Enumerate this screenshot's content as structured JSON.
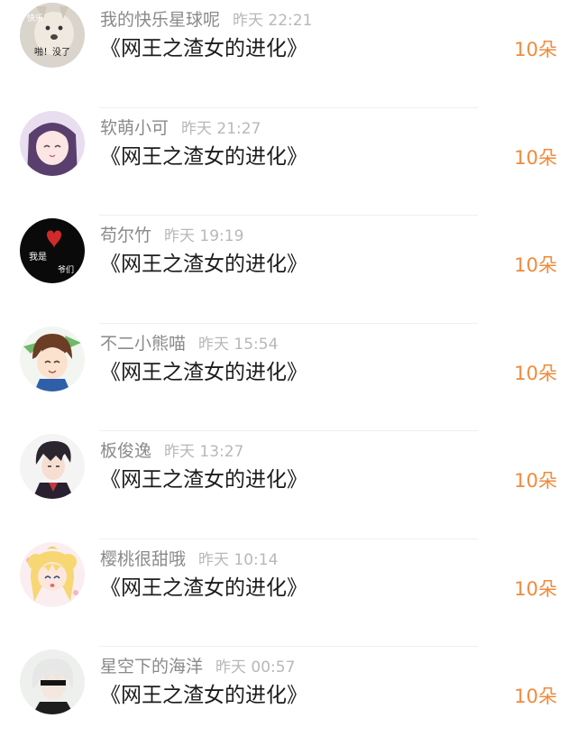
{
  "colors": {
    "amount": "#f08a3a",
    "username": "#8a8a8a",
    "timestamp": "#b8b8b8",
    "title": "#1c1c1c"
  },
  "avatar_label": {
    "a0": "快乐",
    "a1": "啪！没了"
  },
  "avatar_label_2": {
    "a0": "我是",
    "a1": "爷们"
  },
  "entries": [
    {
      "username": "我的快乐星球呢",
      "time": "昨天 22:21",
      "title": "《网王之渣女的进化》",
      "amount": "10朵",
      "avatar_icon": "dog-meme-avatar-icon"
    },
    {
      "username": "软萌小可",
      "time": "昨天 21:27",
      "title": "《网王之渣女的进化》",
      "amount": "10朵",
      "avatar_icon": "anime-girl-avatar-icon"
    },
    {
      "username": "苟尔竹",
      "time": "昨天 19:19",
      "title": "《网王之渣女的进化》",
      "amount": "10朵",
      "avatar_icon": "black-heart-avatar-icon"
    },
    {
      "username": "不二小熊喵",
      "time": "昨天 15:54",
      "title": "《网王之渣女的进化》",
      "amount": "10朵",
      "avatar_icon": "anime-boy-avatar-icon"
    },
    {
      "username": "板俊逸",
      "time": "昨天 13:27",
      "title": "《网王之渣女的进化》",
      "amount": "10朵",
      "avatar_icon": "dark-hair-boy-avatar-icon"
    },
    {
      "username": "樱桃很甜哦",
      "time": "昨天 10:14",
      "title": "《网王之渣女的进化》",
      "amount": "10朵",
      "avatar_icon": "sailor-moon-avatar-icon"
    },
    {
      "username": "星空下的海洋",
      "time": "昨天 00:57",
      "title": "《网王之渣女的进化》",
      "amount": "10朵",
      "avatar_icon": "white-hair-avatar-icon"
    }
  ]
}
